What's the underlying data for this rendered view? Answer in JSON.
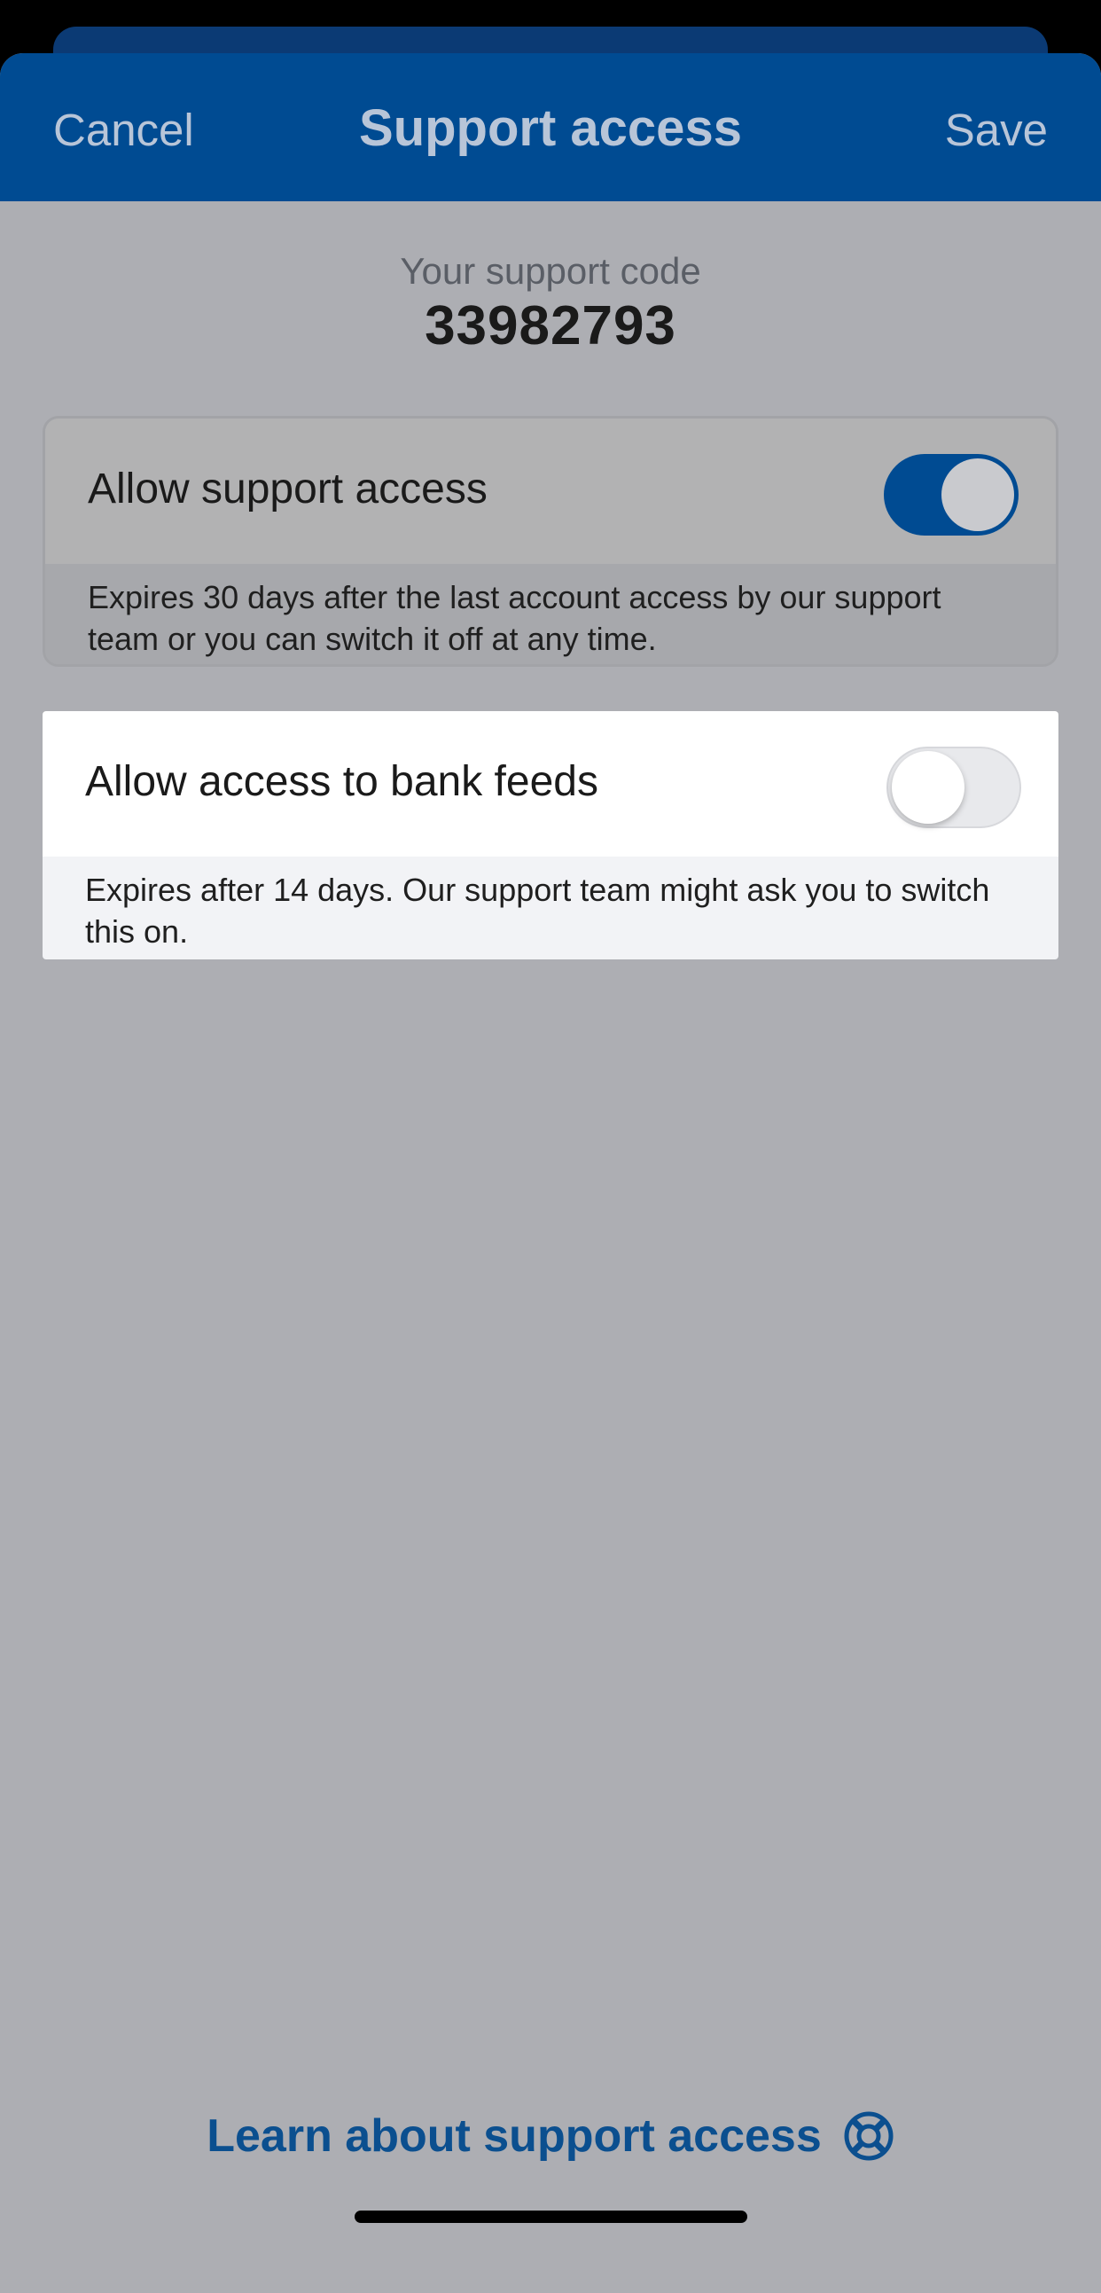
{
  "header": {
    "cancel_label": "Cancel",
    "title": "Support access",
    "save_label": "Save"
  },
  "support_code": {
    "label": "Your support code",
    "value": "33982793"
  },
  "settings": [
    {
      "label": "Allow support access",
      "enabled": true,
      "note": "Expires 30 days after the last account access by our support team or you can switch it off at any time."
    },
    {
      "label": "Allow access to bank feeds",
      "enabled": false,
      "note": "Expires after 14 days. Our support team might ask you to switch this on."
    }
  ],
  "footer": {
    "learn_link": "Learn about support access",
    "icon": "lifebuoy-icon"
  },
  "colors": {
    "brand_blue": "#004b92",
    "overlay_gray": "#adaeb3",
    "link_blue": "#0b4f8f"
  }
}
